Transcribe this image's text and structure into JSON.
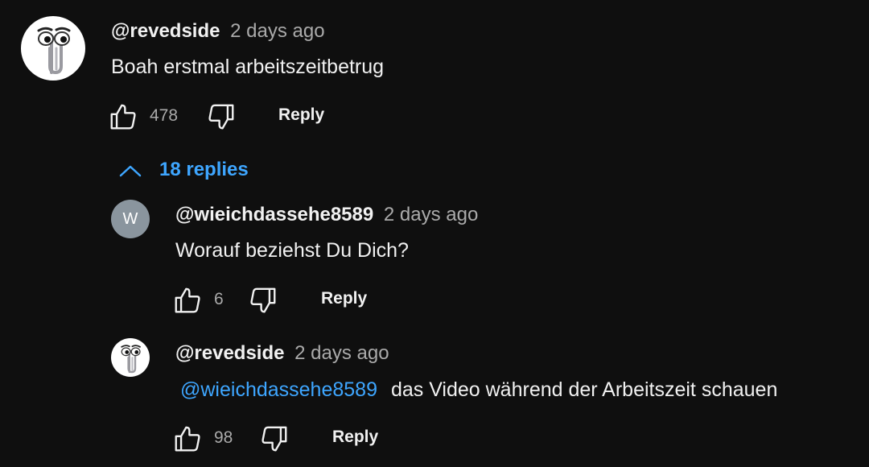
{
  "comment": {
    "author": "@revedside",
    "time": "2 days ago",
    "text": "Boah erstmal arbeitszeitbetrug",
    "likes": "478",
    "reply_label": "Reply",
    "avatar_icon": "clippy-paperclip-icon"
  },
  "replies_toggle": {
    "label": "18 replies",
    "icon": "chevron-up-icon"
  },
  "replies": [
    {
      "author": "@wieichdassehe8589",
      "time": "2 days ago",
      "text": "Worauf beziehst Du Dich?",
      "likes": "6",
      "reply_label": "Reply",
      "avatar_letter": "W"
    },
    {
      "author": "@revedside",
      "time": "2 days ago",
      "mention": "@wieichdassehe8589",
      "text": "das Video während der Arbeitszeit schauen",
      "likes": "98",
      "reply_label": "Reply",
      "avatar_icon": "clippy-paperclip-icon"
    }
  ],
  "colors": {
    "background": "#0f0f0f",
    "link": "#3ea6ff",
    "secondary_text": "#aaaaaa",
    "primary_text": "#f1f1f1"
  }
}
